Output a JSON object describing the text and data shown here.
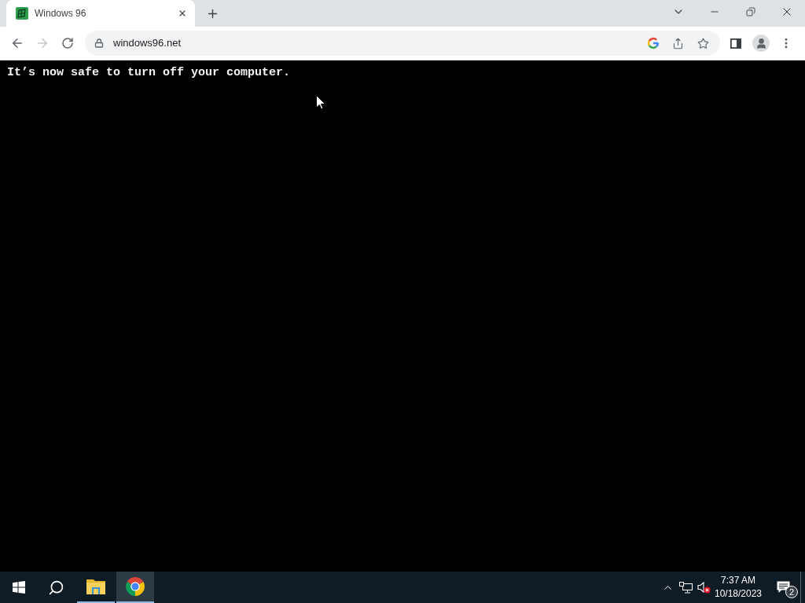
{
  "browser": {
    "tabs": [
      {
        "title": "Windows 96",
        "selected": true
      }
    ],
    "nav_buttons": [
      {
        "kind": "back",
        "disabled": false
      },
      {
        "kind": "forward",
        "disabled": true
      },
      {
        "kind": "reload",
        "disabled": false
      }
    ],
    "url": "windows96.net"
  },
  "page": {
    "message": "It’s now safe to turn off your computer."
  },
  "taskbar": {
    "apps": [
      {
        "kind": "folder",
        "running": true,
        "selected": false
      },
      {
        "kind": "chrome",
        "running": true,
        "selected": true
      }
    ],
    "tray": {
      "volume": {
        "muted": true
      },
      "time": "7:37 AM",
      "date": "10/18/2023",
      "notifications": "2"
    }
  }
}
